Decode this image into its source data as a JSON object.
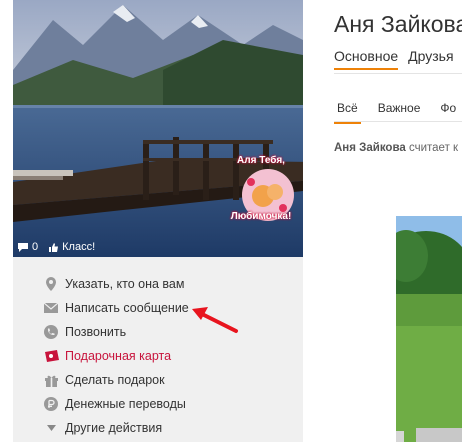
{
  "profile": {
    "name": "Аня Зайкова"
  },
  "avatar": {
    "sticker_line1": "Аля Тебя,",
    "sticker_line2": "Любимочка!",
    "comments_count": "0",
    "class_label": "Класс!"
  },
  "menu": {
    "items": [
      {
        "label": "Указать, кто она вам",
        "icon": "pin-icon"
      },
      {
        "label": "Написать сообщение",
        "icon": "envelope-icon"
      },
      {
        "label": "Позвонить",
        "icon": "phone-icon"
      },
      {
        "label": "Подарочная карта",
        "icon": "gift-card-icon"
      },
      {
        "label": "Сделать подарок",
        "icon": "gift-icon"
      },
      {
        "label": "Денежные переводы",
        "icon": "ruble-icon"
      },
      {
        "label": "Другие действия",
        "icon": "triangle-down-icon"
      }
    ]
  },
  "tabs": [
    {
      "label": "Основное",
      "active": true
    },
    {
      "label": "Друзья",
      "active": false
    }
  ],
  "subtabs": [
    {
      "label": "Всё",
      "active": true
    },
    {
      "label": "Важное",
      "active": false
    },
    {
      "label": "Фо",
      "active": false
    }
  ],
  "feed": {
    "author": "Аня Зайкова",
    "text": "считает к"
  },
  "colors": {
    "accent": "#ee8208",
    "gift_card": "#c8143c",
    "arrow": "#e8141e"
  }
}
